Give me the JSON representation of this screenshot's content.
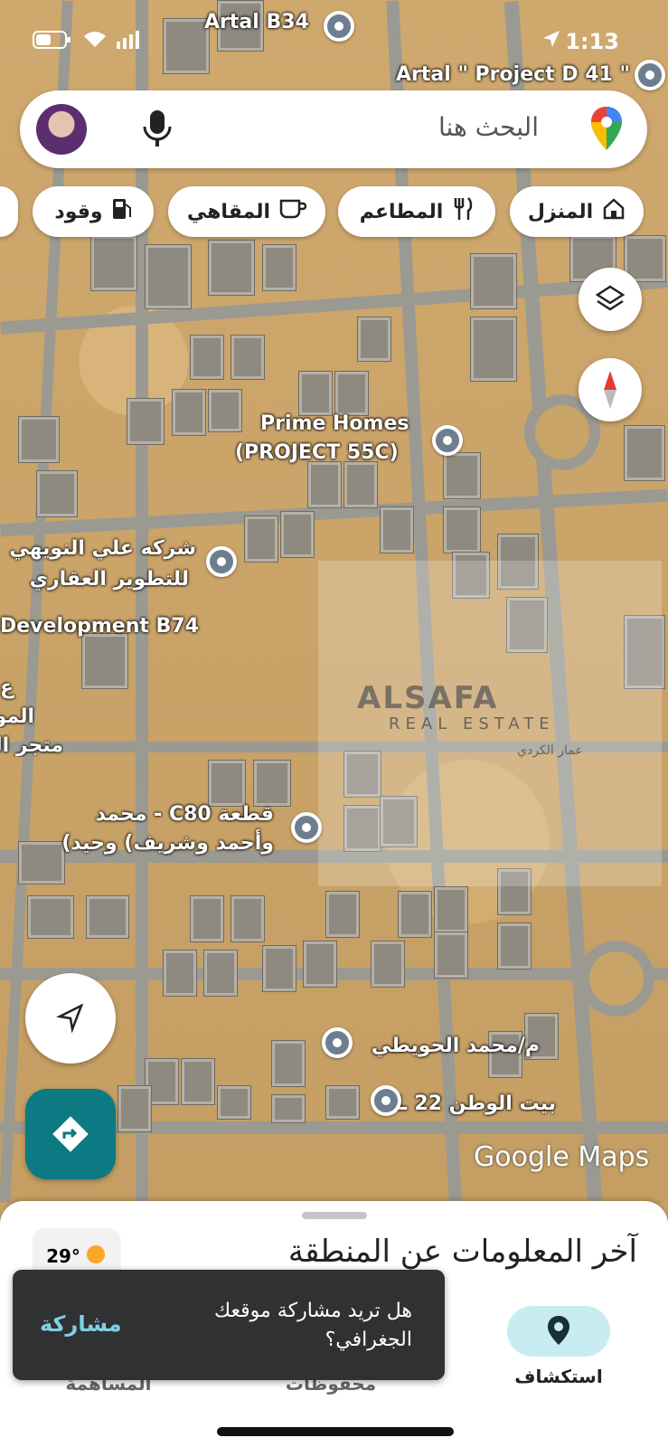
{
  "status_bar": {
    "time": "1:13"
  },
  "search": {
    "placeholder": "البحث هنا"
  },
  "chips": [
    {
      "label": "المنزل",
      "icon": "home-icon"
    },
    {
      "label": "المطاعم",
      "icon": "restaurant-icon"
    },
    {
      "label": "المقاهي",
      "icon": "coffee-icon"
    },
    {
      "label": "وقود",
      "icon": "fuel-icon"
    }
  ],
  "map_labels": {
    "artal_b34": "Artal B34",
    "artal_d41": "Artal \" Project D 41 \"",
    "prime_homes_line1": "Prime Homes",
    "prime_homes_line2": "(PROJECT 55C)",
    "nowaihy_line1": "شركه علي النويهي",
    "nowaihy_line2": "للتطوير العقاري",
    "development_b74": "Development B74",
    "edge_label_1": "ع",
    "edge_label_2": "الموب",
    "edge_label_3": "متجر الد",
    "c80_line1": "قطعة C80 - محمد",
    "c80_line2": "وأحمد وشريف) وحيد)",
    "howaity": "م/محمد الحويطي",
    "beit_alwatan": "بيت الوطن L 22",
    "google_maps": "Google Maps"
  },
  "watermark": {
    "brand": "ALSAFA",
    "sub": "REAL ESTATE",
    "arabic": "عمار الكردي"
  },
  "bottom_sheet": {
    "weather_temp": "29°",
    "title": "آخر المعلومات عن المنطقة"
  },
  "toast": {
    "message": "هل تريد مشاركة موقعك الجغرافي؟",
    "action": "مشاركة"
  },
  "nav": {
    "explore": "استكشاف",
    "saved": "محفوظات",
    "contribute": "المساهمة"
  },
  "colors": {
    "accent": "#0b7a82",
    "explore_pill": "#c8ecf2",
    "toast_action": "#7fd0e6"
  }
}
